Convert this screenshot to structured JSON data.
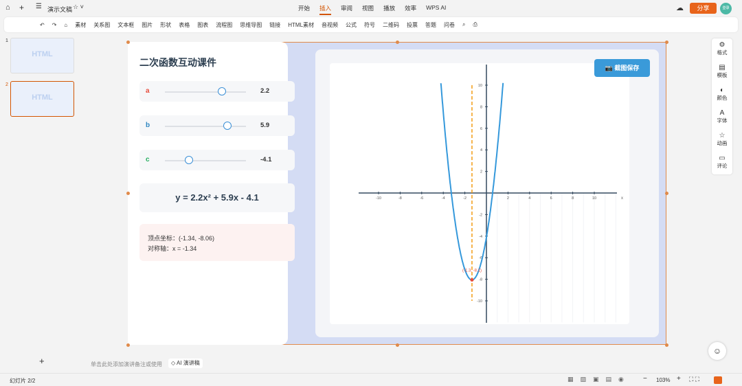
{
  "titlebar": {
    "doc_title": "演示文稿",
    "tabs": [
      "开始",
      "插入",
      "审阅",
      "视图",
      "播放",
      "效率",
      "WPS AI"
    ],
    "active_tab": "插入",
    "share": "分享",
    "avatar": "登录"
  },
  "toolbar": {
    "items": [
      "素材",
      "关系图",
      "文本框",
      "图片",
      "形状",
      "表格",
      "图表",
      "流程图",
      "思维导图",
      "链接",
      "HTML素材",
      "音视频",
      "公式",
      "符号",
      "二维码",
      "投票",
      "答题",
      "问卷"
    ]
  },
  "thumbnails": [
    {
      "num": "1",
      "label": "HTML"
    },
    {
      "num": "2",
      "label": "HTML"
    }
  ],
  "slide": {
    "title": "二次函数互动课件",
    "params": [
      {
        "name": "a",
        "value": "2.2",
        "fraction": 0.7,
        "color": "#e74c3c"
      },
      {
        "name": "b",
        "value": "5.9",
        "fraction": 0.77,
        "color": "#2e86c1"
      },
      {
        "name": "c",
        "value": "-4.1",
        "fraction": 0.3,
        "color": "#27ae60"
      }
    ],
    "equation": "y = 2.2x² + 5.9x - 4.1",
    "vertex_text": "顶点坐标：(-1.34, -8.06)",
    "axis_text": "对称轴：x = -1.34",
    "save_button": "截图保存"
  },
  "chart_data": {
    "type": "line",
    "function": {
      "a": 2.2,
      "b": 5.9,
      "c": -4.1
    },
    "xlim": [
      -12,
      12
    ],
    "ylim": [
      -12,
      12
    ],
    "x_ticks": [
      -10,
      -8,
      -6,
      -4,
      -2,
      2,
      4,
      6,
      8,
      10
    ],
    "y_ticks": [
      10,
      8,
      6,
      4,
      2,
      -2,
      -4,
      -6,
      -8,
      -10
    ],
    "xlabel": "x",
    "vertex": {
      "x": -1.34,
      "y": -8.06,
      "label": "(-1.3, -8.1)"
    },
    "axis_of_symmetry": -1.34,
    "curve_color": "#3498db",
    "axis_line_color": "#f39c12"
  },
  "right_panel": [
    "格式",
    "模板",
    "颜色",
    "字体",
    "动画",
    "评论"
  ],
  "notes": {
    "placeholder": "单击此处添加演讲备注或使用",
    "ai_button": "AI 演讲稿"
  },
  "status": {
    "slide_info": "幻灯片 2/2",
    "zoom": "103%"
  }
}
